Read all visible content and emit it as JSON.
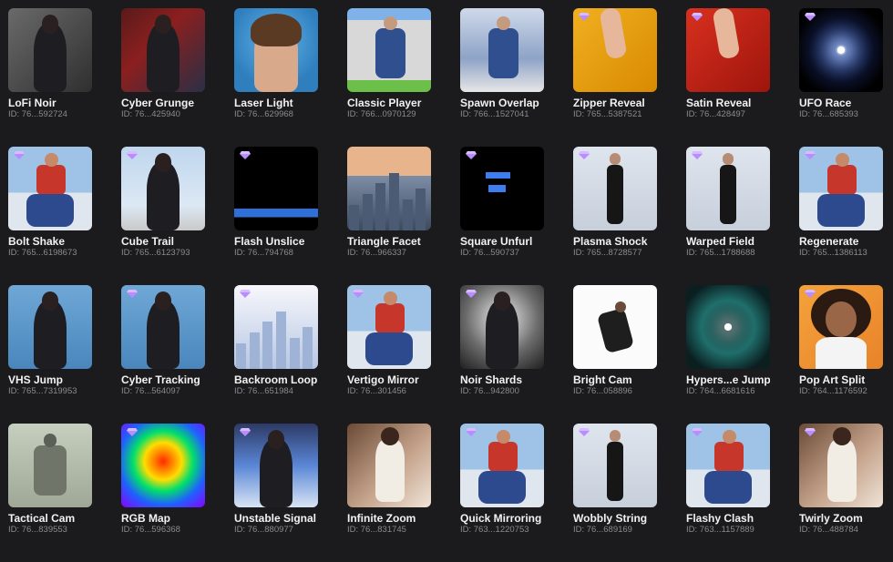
{
  "effects": [
    {
      "name": "LoFi Noir",
      "id": "ID: 76...592724",
      "premium": false,
      "scene": "noir",
      "figure": "person-dark"
    },
    {
      "name": "Cyber Grunge",
      "id": "ID: 76...425940",
      "premium": false,
      "scene": "grunge",
      "figure": "person-dark"
    },
    {
      "name": "Laser Light",
      "id": "ID: 76...629968",
      "premium": false,
      "scene": "laser",
      "figure": "portrait-woman"
    },
    {
      "name": "Classic Player",
      "id": "ID: 766...0970129",
      "premium": false,
      "scene": "player",
      "figure": "person-seated"
    },
    {
      "name": "Spawn Overlap",
      "id": "ID: 766...1527041",
      "premium": false,
      "scene": "overlap",
      "figure": "person-seated"
    },
    {
      "name": "Zipper Reveal",
      "id": "ID: 765...5387521",
      "premium": true,
      "scene": "zipper",
      "figure": "hand"
    },
    {
      "name": "Satin Reveal",
      "id": "ID: 76...428497",
      "premium": true,
      "scene": "satin",
      "figure": "hand"
    },
    {
      "name": "UFO Race",
      "id": "ID: 76...685393",
      "premium": true,
      "scene": "warp",
      "figure": "none"
    },
    {
      "name": "Bolt Shake",
      "id": "ID: 765...6198673",
      "premium": true,
      "scene": "rooftop",
      "figure": "person-red"
    },
    {
      "name": "Cube Trail",
      "id": "ID: 765...6123793",
      "premium": true,
      "scene": "sky",
      "figure": "person-dark"
    },
    {
      "name": "Flash Unslice",
      "id": "ID: 76...794768",
      "premium": true,
      "scene": "black-slice",
      "figure": "none"
    },
    {
      "name": "Triangle Facet",
      "id": "ID: 76...966337",
      "premium": false,
      "scene": "city",
      "figure": "none"
    },
    {
      "name": "Square Unfurl",
      "id": "ID: 76...590737",
      "premium": true,
      "scene": "black-squares",
      "figure": "none"
    },
    {
      "name": "Plasma Shock",
      "id": "ID: 765...8728577",
      "premium": true,
      "scene": "studio",
      "figure": "person-standing"
    },
    {
      "name": "Warped Field",
      "id": "ID: 765...1788688",
      "premium": true,
      "scene": "studio",
      "figure": "person-standing"
    },
    {
      "name": "Regenerate",
      "id": "ID: 765...1386113",
      "premium": true,
      "scene": "rooftop",
      "figure": "person-red"
    },
    {
      "name": "VHS Jump",
      "id": "ID: 765...7319953",
      "premium": false,
      "scene": "blue",
      "figure": "person-dark"
    },
    {
      "name": "Cyber Tracking",
      "id": "ID: 76...564097",
      "premium": true,
      "scene": "blue-grid",
      "figure": "person-dark"
    },
    {
      "name": "Backroom Loop",
      "id": "ID: 76...651984",
      "premium": true,
      "scene": "city-bright",
      "figure": "none"
    },
    {
      "name": "Vertigo Mirror",
      "id": "ID: 76...301456",
      "premium": true,
      "scene": "rooftop",
      "figure": "person-red"
    },
    {
      "name": "Noir Shards",
      "id": "ID: 76...942800",
      "premium": true,
      "scene": "noir-spot",
      "figure": "person-dark"
    },
    {
      "name": "Bright Cam",
      "id": "ID: 76...058896",
      "premium": false,
      "scene": "white-cam",
      "figure": "person-jump"
    },
    {
      "name": "Hypers...e Jump",
      "id": "ID: 764...6681616",
      "premium": false,
      "scene": "teal-burst",
      "figure": "none"
    },
    {
      "name": "Pop Art Split",
      "id": "ID: 764...1176592",
      "premium": true,
      "scene": "orange",
      "figure": "portrait-curly"
    },
    {
      "name": "Tactical Cam",
      "id": "ID: 76...839553",
      "premium": false,
      "scene": "green-cam",
      "figure": "person-seated-gray"
    },
    {
      "name": "RGB Map",
      "id": "ID: 76...596368",
      "premium": true,
      "scene": "thermal",
      "figure": "none"
    },
    {
      "name": "Unstable Signal",
      "id": "ID: 76...880977",
      "premium": true,
      "scene": "glitch-blue",
      "figure": "person-dark"
    },
    {
      "name": "Infinite Zoom",
      "id": "ID: 76...831745",
      "premium": false,
      "scene": "warm-blur",
      "figure": "person-back"
    },
    {
      "name": "Quick Mirroring",
      "id": "ID: 763...1220753",
      "premium": true,
      "scene": "rooftop",
      "figure": "person-red"
    },
    {
      "name": "Wobbly String",
      "id": "ID: 76...689169",
      "premium": true,
      "scene": "studio",
      "figure": "person-standing"
    },
    {
      "name": "Flashy Clash",
      "id": "ID: 763...1157889",
      "premium": true,
      "scene": "rooftop",
      "figure": "person-red"
    },
    {
      "name": "Twirly Zoom",
      "id": "ID: 76...488784",
      "premium": true,
      "scene": "warm-blur",
      "figure": "person-back"
    }
  ]
}
